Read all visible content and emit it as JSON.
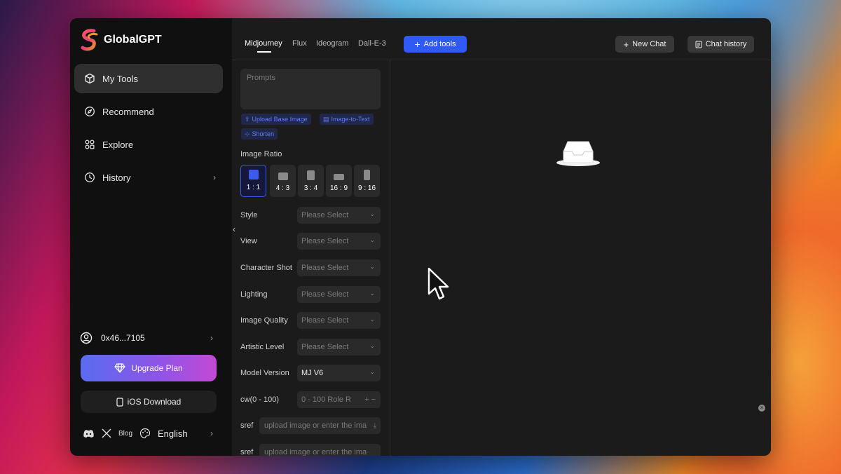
{
  "app": {
    "name": "GlobalGPT",
    "brand_color": "#2f5af5"
  },
  "sidebar": {
    "items": [
      {
        "label": "My Tools",
        "icon": "box-icon",
        "active": true
      },
      {
        "label": "Recommend",
        "icon": "compass-icon"
      },
      {
        "label": "Explore",
        "icon": "grid-icon"
      },
      {
        "label": "History",
        "icon": "clock-icon",
        "has_arrow": true
      }
    ],
    "account": {
      "name": "0x46...7105",
      "icon": "user-circle-icon"
    },
    "upgrade_label": "Upgrade Plan",
    "ios_label": "iOS Download",
    "footer": {
      "blog_label": "Blog",
      "language": "English"
    }
  },
  "topbar": {
    "tabs": [
      "Midjourney",
      "Flux",
      "Ideogram",
      "Dall-E-3"
    ],
    "active_tab": "Midjourney",
    "add_tools_label": "Add tools",
    "new_chat_label": "New Chat",
    "chat_history_label": "Chat history"
  },
  "panel": {
    "prompt_placeholder": "Prompts",
    "chips": [
      "Upload Base Image",
      "Image-to-Text",
      "Shorten"
    ],
    "image_ratio_label": "Image Ratio",
    "ratios": [
      "1 : 1",
      "4 : 3",
      "3 : 4",
      "16 : 9",
      "9 : 16"
    ],
    "selected_ratio": "1 : 1",
    "fields": [
      {
        "label": "Style",
        "value": "Please Select"
      },
      {
        "label": "View",
        "value": "Please Select"
      },
      {
        "label": "Character Shot",
        "value": "Please Select"
      },
      {
        "label": "Lighting",
        "value": "Please Select"
      },
      {
        "label": "Image Quality",
        "value": "Please Select"
      },
      {
        "label": "Artistic Level",
        "value": "Please Select"
      },
      {
        "label": "Model Version",
        "value": "MJ V6"
      }
    ],
    "cw": {
      "label": "cw(0 - 100)",
      "placeholder": "0 - 100 Role R"
    },
    "sref": [
      {
        "label": "sref",
        "placeholder": "upload image or enter the ima"
      },
      {
        "label": "sref",
        "placeholder": "upload image or enter the ima"
      }
    ]
  }
}
